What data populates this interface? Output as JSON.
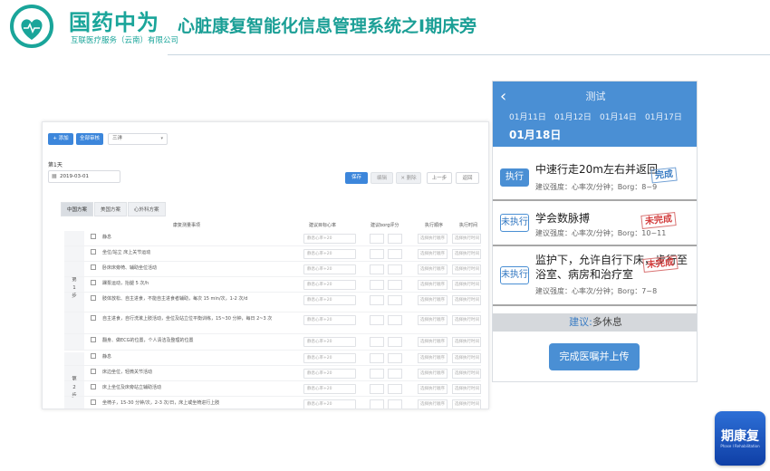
{
  "header": {
    "brand_name": "国药中为",
    "brand_sub": "互联医疗服务（云南）有限公司",
    "title": "心脏康复智能化信息管理系统之Ⅰ期床旁"
  },
  "left_panel": {
    "toolbar": {
      "add_label": "+ 添加",
      "approve_all_label": "全部审核",
      "select_value": "三洋"
    },
    "day_label": "第1天",
    "date_value": "2019-03-01",
    "actions": {
      "save": "保存",
      "edit": "编辑",
      "delete": "删除",
      "prev": "上一步",
      "back": "返回"
    },
    "tabs": [
      {
        "label": "中国方案",
        "active": true
      },
      {
        "label": "美国方案",
        "active": false
      },
      {
        "label": "心外科方案",
        "active": false
      }
    ],
    "table_headers": {
      "task": "康复测量事项",
      "hr": "建议目标心率",
      "borg": "建议borg评分",
      "order": "执行顺序",
      "time": "执行时间"
    },
    "steps": [
      {
        "label": "第 1 步"
      },
      {
        "label": "第 2 步"
      }
    ],
    "rows": [
      {
        "text": "静息",
        "placeholder": "静息心率+20"
      },
      {
        "text": "坐位/站立     床上关节运动",
        "placeholder": "静息心率+20"
      },
      {
        "text": "卧床床旁椅、辅助坐位活动",
        "placeholder": "静息心率+20"
      },
      {
        "text": "踝泵运动，抬腿 5 次/h",
        "placeholder": "静息心率+20"
      },
      {
        "text": "肢体放松、自主进食，不能自主进食者辅助，每次 15 min/次，1-2 次/d",
        "placeholder": "静息心率+20"
      },
      {
        "text": "自主进食，自行洗漱上肢活动，坐位及站立位平衡训练，15~30 分钟，每日 2~3 次",
        "placeholder": "静息心率+20"
      },
      {
        "text": "翻身、做ECG的位置，个人清洁及整理的位置",
        "placeholder": "静息心率+20"
      },
      {
        "text": "静息",
        "placeholder": "静息心率+20"
      },
      {
        "text": "床边坐位，轻微关节活动",
        "placeholder": "静息心率+20"
      },
      {
        "text": "床上坐位及床旁站立辅助活动",
        "placeholder": "静息心率+20"
      },
      {
        "text": "坐椅子，15-30 分钟/次，2-3 次/日，床上或坐椅进行上肢",
        "placeholder": "静息心率+20"
      }
    ],
    "select_placeholders": {
      "order": "选择执行顺序",
      "time": "选择执行时间"
    }
  },
  "phone": {
    "title": "测试",
    "dates": [
      "01月11日",
      "01月12日",
      "01月14日",
      "01月17日"
    ],
    "active_date": "01月18日",
    "tasks": [
      {
        "status": "执行",
        "done": true,
        "title": "中速行走20m左右并返回",
        "meta": "建议强度：心率次/分钟；Borg：8~9",
        "stamp": "完成",
        "stamp_color": "#3d7ec4"
      },
      {
        "status": "未执行",
        "done": false,
        "title": "学会数脉搏",
        "meta": "建议强度：心率次/分钟；Borg：10~11",
        "stamp": "未完成",
        "stamp_color": "#d23a3a"
      },
      {
        "status": "未执行",
        "done": false,
        "title_line1": "监护下，允许自行下床，步行至",
        "title_line2": "浴室、病房和治疗室",
        "meta": "建议强度：心率次/分钟；Borg：7~8",
        "stamp": "未完成",
        "stamp_color": "#d23a3a"
      }
    ],
    "advice_key": "建议:",
    "advice_value": "多休息",
    "upload_label": "完成医嘱并上传"
  },
  "app_icon": {
    "label": "期康复",
    "sub": "Phase I Rehabilitation"
  },
  "colors": {
    "brand_teal": "#1aa59a",
    "phone_blue": "#4a8fd4",
    "button_blue": "#3c86db",
    "stamp_red": "#d23a3a"
  }
}
